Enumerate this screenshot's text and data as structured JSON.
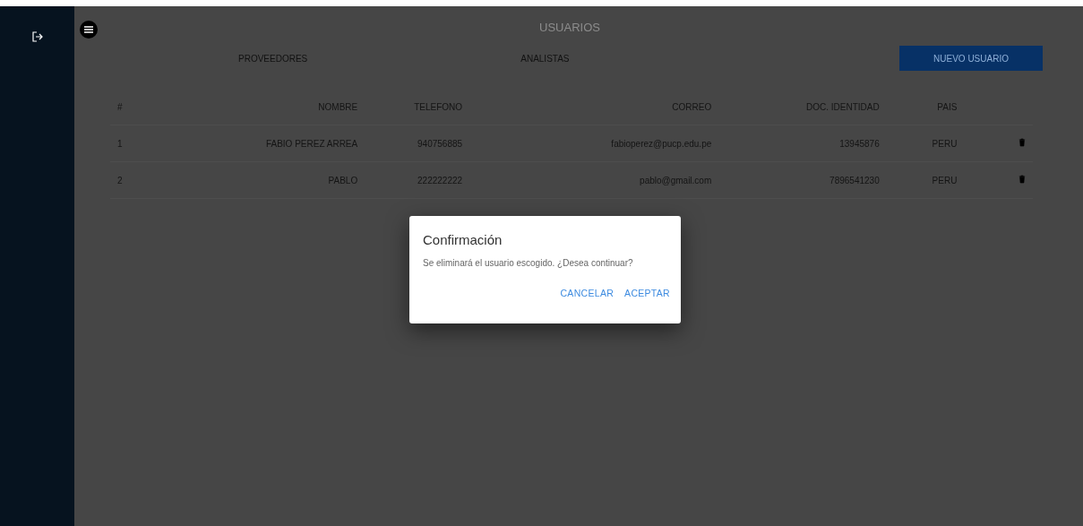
{
  "page_title": "USUARIOS",
  "links": [
    "PROVEEDORES",
    "ANALISTAS"
  ],
  "new_button": "NUEVO USUARIO",
  "table": {
    "columns": [
      "#",
      "NOMBRE",
      "TELEFONO",
      "CORREO",
      "DOC. IDENTIDAD",
      "PAIS"
    ],
    "rows": [
      {
        "cells": [
          "1",
          "FABIO PEREZ ARREA",
          "940756885",
          "fabioperez@pucp.edu.pe",
          "13945876",
          "PERU"
        ]
      },
      {
        "cells": [
          "2",
          "PABLO",
          "222222222",
          "pablo@gmail.com",
          "7896541230",
          "PERU"
        ]
      }
    ]
  },
  "dialog": {
    "title": "Confirmación",
    "message": "Se eliminará el usuario escogido. ¿Desea continuar?",
    "buttons": [
      "CANCELAR",
      "ACEPTAR"
    ]
  }
}
